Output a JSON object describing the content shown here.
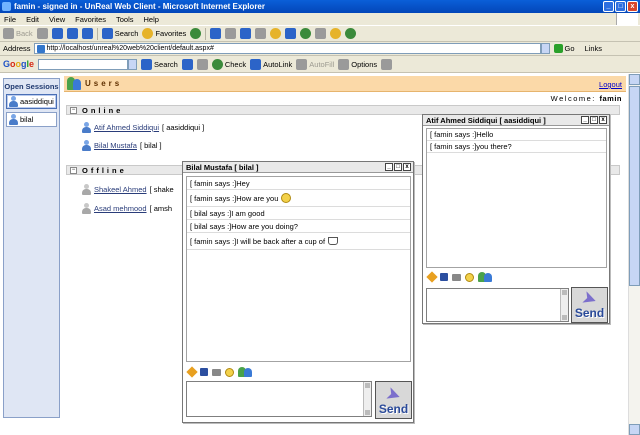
{
  "window": {
    "title": "famin - signed in - UnReal Web Client - Microsoft Internet Explorer",
    "min": "_",
    "max": "□",
    "close": "x"
  },
  "menu": [
    "File",
    "Edit",
    "View",
    "Favorites",
    "Tools",
    "Help"
  ],
  "toolbar": {
    "back": "Back",
    "search": "Search",
    "favorites": "Favorites"
  },
  "address": {
    "label": "Address",
    "url": "http://localhost/unreal%20web%20client/default.aspx#",
    "go": "Go",
    "links": "Links"
  },
  "google": {
    "logo": "Google",
    "search": "Search",
    "check": "Check",
    "autolink": "AutoLink",
    "autofill": "AutoFill",
    "options": "Options"
  },
  "sessions": {
    "title": "Open Sessions",
    "items": [
      {
        "label": "aasiddiqui"
      },
      {
        "label": "bilal"
      }
    ]
  },
  "users": {
    "title": "Users",
    "logout": "Logout",
    "welcome_prefix": "Welcome:",
    "welcome_user": "famin",
    "online_label": "Online",
    "offline_label": "Offline",
    "online": [
      {
        "name": "Atif Ahmed Siddiqui",
        "handle": "[ aasiddiqui ]"
      },
      {
        "name": "Bilal Mustafa",
        "handle": "[ bilal ]"
      }
    ],
    "offline": [
      {
        "name": "Shakeel Ahmed",
        "handle": "[ shake"
      },
      {
        "name": "Asad mehmood",
        "handle": "[ amsh"
      }
    ]
  },
  "chat_bilal": {
    "title": "Bilal Mustafa [ bilal ]",
    "messages": [
      {
        "text": "[ famin says :]Hey",
        "emoticon": ""
      },
      {
        "text": "[ famin says :]How are you",
        "emoticon": "smiley"
      },
      {
        "text": "[ bilal says :]I am good",
        "emoticon": ""
      },
      {
        "text": "[ bilal says :]How are you doing?",
        "emoticon": ""
      },
      {
        "text": "[ famin says :]I will be back after a cup of",
        "emoticon": "coffee-cup"
      }
    ],
    "send": "Send"
  },
  "chat_atif": {
    "title": "Atif Ahmed Siddiqui [ aasiddiqui ]",
    "messages": [
      {
        "text": "[ famin says :]Hello"
      },
      {
        "text": "[ famin says :]you there?"
      }
    ],
    "send": "Send"
  }
}
